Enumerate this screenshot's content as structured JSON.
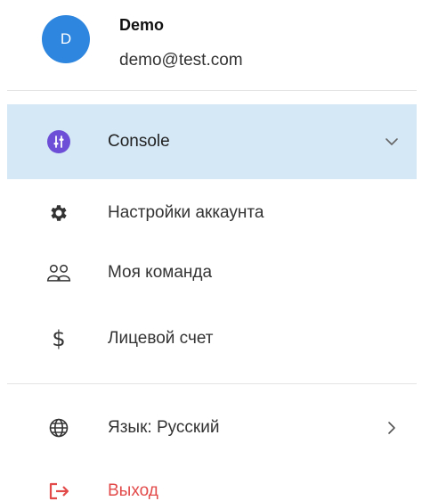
{
  "profile": {
    "avatar_letter": "D",
    "name": "Demo",
    "email": "demo@test.com",
    "avatar_color": "#2e86de"
  },
  "menu": {
    "console": {
      "label": "Console",
      "icon": "sliders-icon",
      "trailing_icon": "chevron-down-icon",
      "active": true
    },
    "settings": {
      "label": "Настройки аккаунта",
      "icon": "gear-icon"
    },
    "team": {
      "label": "Моя команда",
      "icon": "users-icon"
    },
    "billing": {
      "label": "Лицевой счет",
      "icon": "dollar-icon"
    },
    "language": {
      "label": "Язык: Русский",
      "icon": "globe-icon",
      "trailing_icon": "chevron-right-icon"
    },
    "logout": {
      "label": "Выход",
      "icon": "logout-icon"
    }
  },
  "colors": {
    "active_bg": "#d5e8f6",
    "console_badge": "#6c4fd6",
    "logout_red": "#e24a4a"
  }
}
